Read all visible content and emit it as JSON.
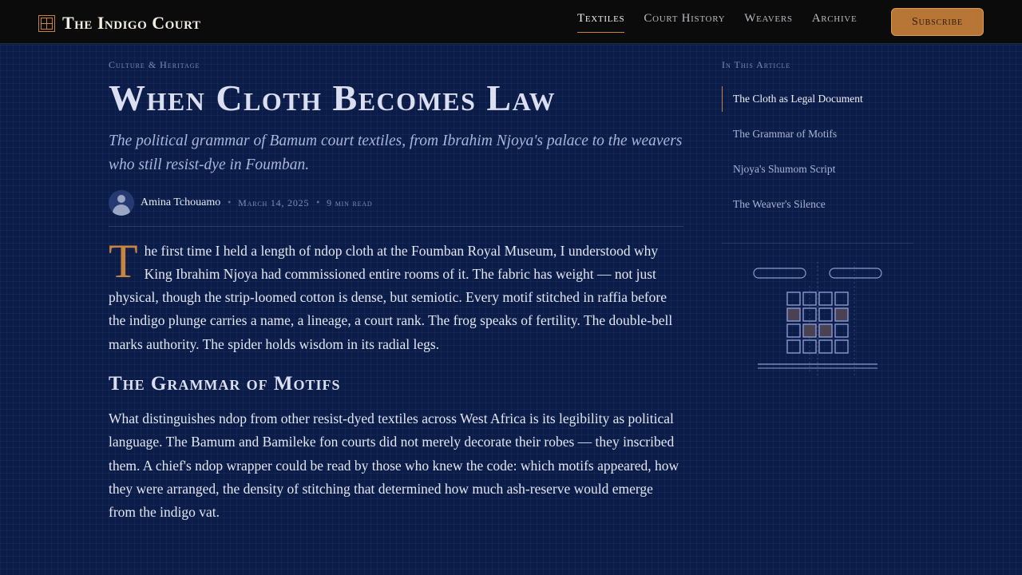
{
  "header": {
    "brand": "The Indigo Court",
    "nav": [
      {
        "label": "Textiles",
        "active": true
      },
      {
        "label": "Court History",
        "active": false
      },
      {
        "label": "Weavers",
        "active": false
      },
      {
        "label": "Archive",
        "active": false
      }
    ],
    "subscribe_label": "Subscribe"
  },
  "article": {
    "eyebrow": "Culture & Heritage",
    "title": "When Cloth Becomes Law",
    "dek": "The political grammar of Bamum court textiles, from Ibrahim Njoya's palace to the weavers who still resist-dye in Foumban.",
    "author": "Amina Tchouamo",
    "date": "March 14, 2025",
    "read_time": "9 min read",
    "dropcap": "T",
    "para1": "he first time I held a length of ndop cloth at the Foumban Royal Museum, I understood why King Ibrahim Njoya had commissioned entire rooms of it. The fabric has weight — not just physical, though the strip-loomed cotton is dense, but semiotic. Every motif stitched in raffia before the indigo plunge carries a name, a lineage, a court rank. The frog speaks of fertility. The double-bell marks authority. The spider holds wisdom in its radial legs.",
    "section_heading": "The Grammar of Motifs",
    "para2": "What distinguishes ndop from other resist-dyed textiles across West Africa is its legibility as political language. The Bamum and Bamileke fon courts did not merely decorate their robes — they inscribed them. A chief's ndop wrapper could be read by those who knew the code: which motifs appeared, how they were arranged, the density of stitching that determined how much ash-reserve would emerge from the indigo vat."
  },
  "toc": {
    "heading": "In This Article",
    "items": [
      {
        "label": "The Cloth as Legal Document",
        "active": true
      },
      {
        "label": "The Grammar of Motifs",
        "active": false
      },
      {
        "label": "Njoya's Shumom Script",
        "active": false
      },
      {
        "label": "The Weaver's Silence",
        "active": false
      }
    ]
  },
  "colors": {
    "background": "#0b1c48",
    "accent": "#c8843f",
    "header_bg": "#0b0b0b",
    "motif_stroke": "#8a9ad0",
    "motif_fill": "#4a4252"
  },
  "motif_grid": {
    "rows": 4,
    "cols": 4,
    "filled": [
      [
        1,
        0
      ],
      [
        1,
        3
      ],
      [
        2,
        1
      ],
      [
        2,
        2
      ]
    ]
  }
}
